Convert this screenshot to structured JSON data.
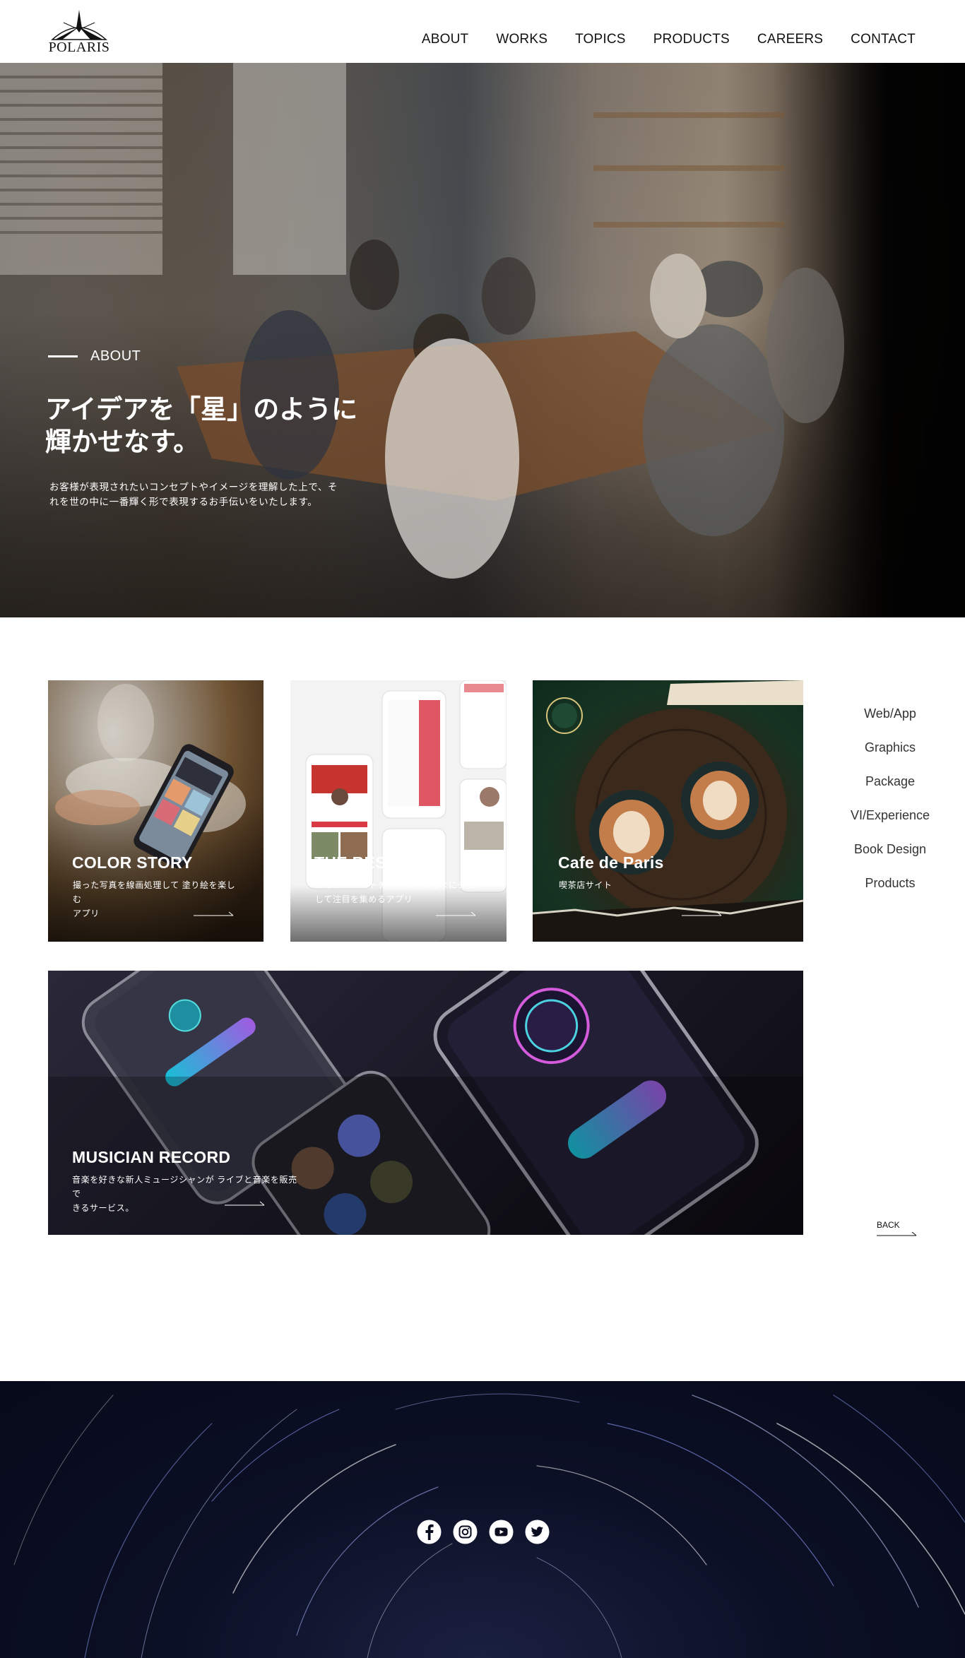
{
  "header": {
    "logo_text": "POLARIS",
    "nav": [
      "ABOUT",
      "WORKS",
      "TOPICS",
      "PRODUCTS",
      "CAREERS",
      "CONTACT"
    ]
  },
  "hero": {
    "section_label": "ABOUT",
    "title_line1": "アイデアを「星」のように",
    "title_line2": "輝かせなす。",
    "desc_line1": "お客様が表現されたいコンセプトやイメージを理解した上で、そ",
    "desc_line2": "れを世の中に一番輝く形で表現するお手伝いをいたします。"
  },
  "works": [
    {
      "title": "COLOR STORY",
      "desc_line1": "撮った写真を線画処理して 塗り絵を楽しむ",
      "desc_line2": "アプリ"
    },
    {
      "title": "THE BEST",
      "desc_line1": "あなたのベストチョイスをみんなにシェア",
      "desc_line2": "して注目を集めるアプリ"
    },
    {
      "title": "Cafe de Paris",
      "desc_line1": "喫茶店サイト",
      "desc_line2": ""
    },
    {
      "title": "MUSICIAN RECORD",
      "desc_line1": "音楽を好きな新人ミュージシャンが ライブと音楽を販売で",
      "desc_line2": "きるサービス。"
    }
  ],
  "categories": [
    "Web/App",
    "Graphics",
    "Package",
    "VI/Experience",
    "Book Design",
    "Products"
  ],
  "back_label": "BACK",
  "social_icons": [
    "facebook-icon",
    "instagram-icon",
    "youtube-icon",
    "twitter-icon"
  ],
  "colors": {
    "text": "#111111",
    "footer_bg": "#070a1a",
    "accent_white": "#ffffff"
  }
}
